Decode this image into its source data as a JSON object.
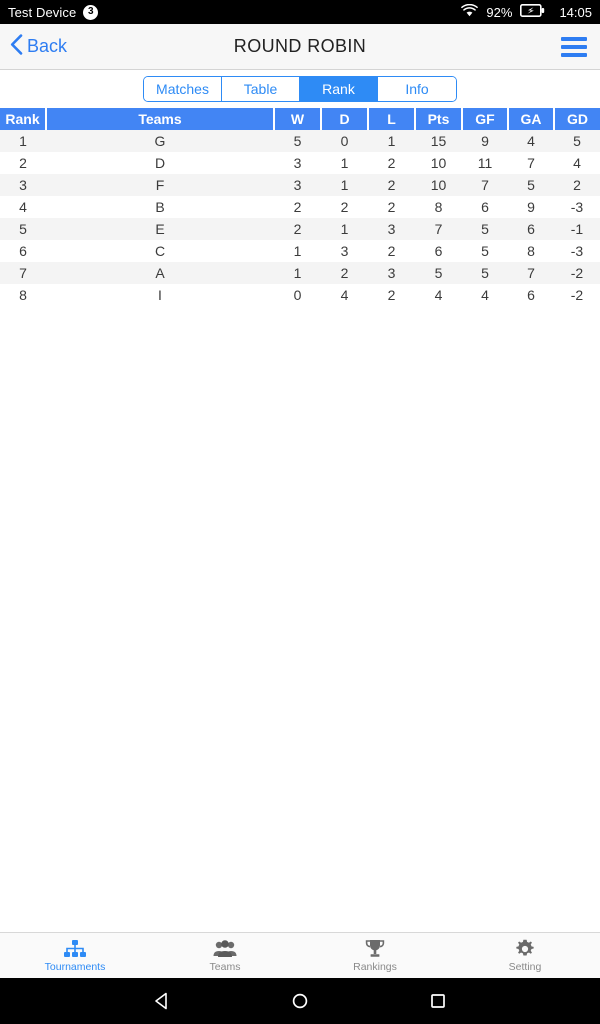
{
  "statusbar": {
    "device": "Test Device",
    "badge": "3",
    "battery_pct": "92%",
    "time": "14:05",
    "wifi_icon": "wifi-icon",
    "battery_icon": "battery-charging-icon"
  },
  "navbar": {
    "back_label": "Back",
    "title": "ROUND ROBIN",
    "back_icon": "chevron-left-icon",
    "menu_icon": "hamburger-menu-icon"
  },
  "tabs": {
    "items": [
      {
        "label": "Matches",
        "active": false
      },
      {
        "label": "Table",
        "active": false
      },
      {
        "label": "Rank",
        "active": true
      },
      {
        "label": "Info",
        "active": false
      }
    ]
  },
  "table": {
    "columns": [
      "Rank",
      "Teams",
      "W",
      "D",
      "L",
      "Pts",
      "GF",
      "GA",
      "GD"
    ],
    "header_colors": {
      "default": "#4285f4",
      "pts": "#f59b00",
      "gd": "#54d06e"
    },
    "rows": [
      {
        "rank": "1",
        "team": "G",
        "w": "5",
        "d": "0",
        "l": "1",
        "pts": "15",
        "gf": "9",
        "ga": "4",
        "gd": "5"
      },
      {
        "rank": "2",
        "team": "D",
        "w": "3",
        "d": "1",
        "l": "2",
        "pts": "10",
        "gf": "11",
        "ga": "7",
        "gd": "4"
      },
      {
        "rank": "3",
        "team": "F",
        "w": "3",
        "d": "1",
        "l": "2",
        "pts": "10",
        "gf": "7",
        "ga": "5",
        "gd": "2"
      },
      {
        "rank": "4",
        "team": "B",
        "w": "2",
        "d": "2",
        "l": "2",
        "pts": "8",
        "gf": "6",
        "ga": "9",
        "gd": "-3"
      },
      {
        "rank": "5",
        "team": "E",
        "w": "2",
        "d": "1",
        "l": "3",
        "pts": "7",
        "gf": "5",
        "ga": "6",
        "gd": "-1"
      },
      {
        "rank": "6",
        "team": "C",
        "w": "1",
        "d": "3",
        "l": "2",
        "pts": "6",
        "gf": "5",
        "ga": "8",
        "gd": "-3"
      },
      {
        "rank": "7",
        "team": "A",
        "w": "1",
        "d": "2",
        "l": "3",
        "pts": "5",
        "gf": "5",
        "ga": "7",
        "gd": "-2"
      },
      {
        "rank": "8",
        "team": "I",
        "w": "0",
        "d": "4",
        "l": "2",
        "pts": "4",
        "gf": "4",
        "ga": "6",
        "gd": "-2"
      }
    ]
  },
  "bottombar": {
    "items": [
      {
        "label": "Tournaments",
        "icon": "bracket-tree-icon",
        "active": true
      },
      {
        "label": "Teams",
        "icon": "people-group-icon",
        "active": false
      },
      {
        "label": "Rankings",
        "icon": "trophy-icon",
        "active": false
      },
      {
        "label": "Setting",
        "icon": "gear-icon",
        "active": false
      }
    ]
  },
  "softkeys": {
    "back": "android-back-icon",
    "home": "android-home-icon",
    "recents": "android-recents-icon"
  },
  "colors": {
    "accent_blue": "#2e8bf5",
    "header_blue": "#4285f4",
    "pts_orange": "#f59b00",
    "gd_green": "#54d06e",
    "row_stripe": "#f4f4f4"
  }
}
